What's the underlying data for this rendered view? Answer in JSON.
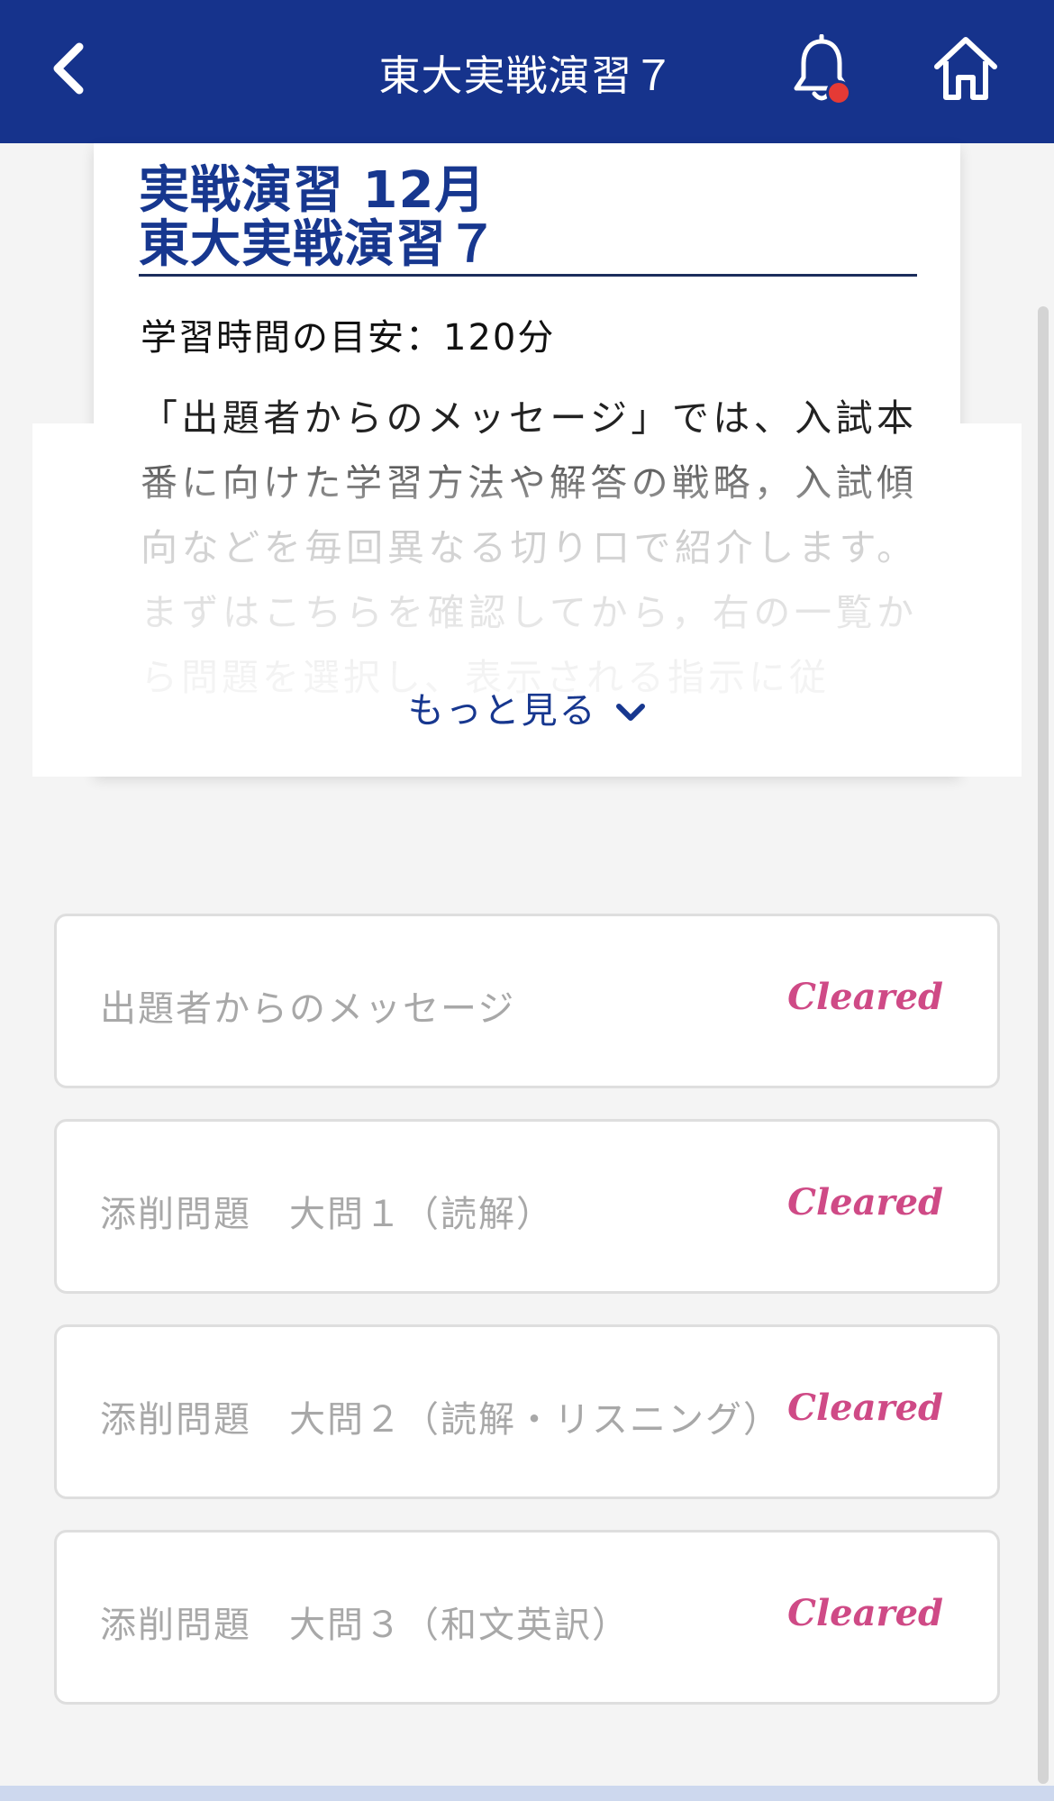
{
  "header": {
    "title": "東大実戦演習７",
    "back_icon": "chevron-left-icon",
    "bell_icon": "bell-icon",
    "home_icon": "home-icon",
    "notification_dot_color": "#e53a35",
    "background_color": "#16338c"
  },
  "card": {
    "title_line1": "実戦演習 12月",
    "title_line2": "東大実戦演習７",
    "study_time": "学習時間の目安：120分",
    "description": "「出題者からのメッセージ」では、入試本番に向けた学習方法や解答の戦略，入試傾向などを毎回異なる切り口で紹介します。まずはこちらを確認してから，右の一覧から問題を選択し、表示される指示に従",
    "more_label": "もっと見る",
    "more_icon": "chevron-down-icon"
  },
  "tasks": [
    {
      "label": "出題者からのメッセージ",
      "status": "Cleared"
    },
    {
      "label": "添削問題　大問１（読解）",
      "status": "Cleared"
    },
    {
      "label": "添削問題　大問２（読解・リスニング）",
      "status": "Cleared"
    },
    {
      "label": "添削問題　大問３（和文英訳）",
      "status": "Cleared"
    }
  ],
  "colors": {
    "accent": "#17378f",
    "cleared": "#cf4a86"
  }
}
